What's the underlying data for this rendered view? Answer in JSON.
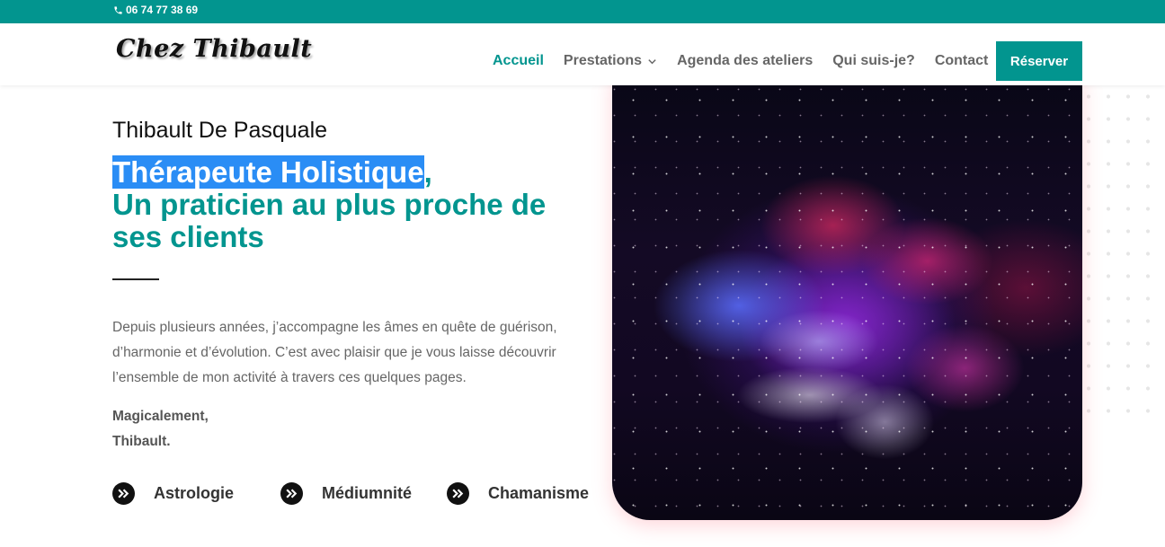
{
  "topbar": {
    "phone": "06 74 77 38 69",
    "phone_icon": "phone-icon"
  },
  "header": {
    "logo": "Chez Thibault",
    "nav": [
      {
        "label": "Accueil",
        "active": true
      },
      {
        "label": "Prestations",
        "dropdown": true
      },
      {
        "label": "Agenda des ateliers"
      },
      {
        "label": "Qui suis-je?"
      },
      {
        "label": "Contact"
      }
    ],
    "cta": "Réserver"
  },
  "hero": {
    "name": "Thibault De Pasquale",
    "headline_highlight": "Thérapeute Holistique",
    "headline_comma": ",",
    "headline_rest": "Un praticien au plus proche de ses clients",
    "intro": "Depuis plusieurs années, j’accompagne les âmes en quête de guérison, d’harmonie et d’évolution. C’est avec plaisir que je vous laisse découvrir l’ensemble de mon activité à travers ces quelques pages.",
    "signoff_line1": "Magicalement,",
    "signoff_line2": "Thibault.",
    "services": [
      {
        "label": "Astrologie",
        "icon": "double-chevron-right-icon"
      },
      {
        "label": "Médiumnité",
        "icon": "double-chevron-right-icon"
      },
      {
        "label": "Chamanisme",
        "icon": "double-chevron-right-icon"
      }
    ]
  },
  "colors": {
    "accent": "#02958f",
    "highlight": "#2a8df5",
    "text": "#666666"
  }
}
